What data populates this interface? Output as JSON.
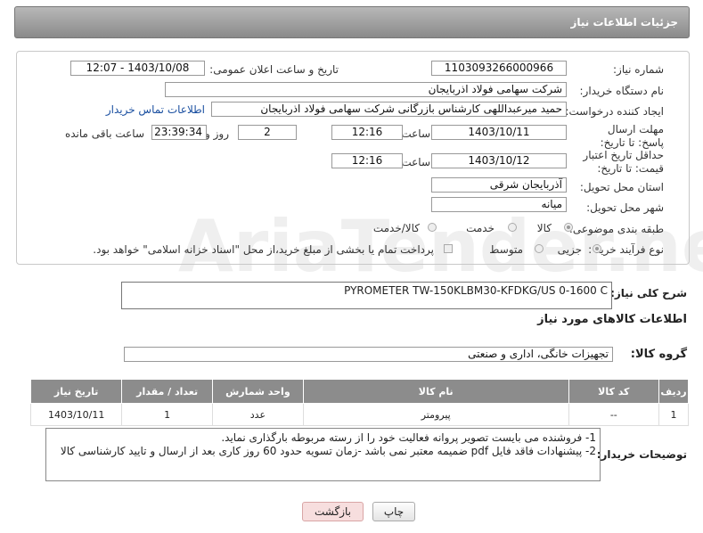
{
  "header": {
    "title": "جزئیات اطلاعات نیاز"
  },
  "form": {
    "need_number_label": "شماره نیاز:",
    "need_number": "1103093266000966",
    "announce_label": "تاریخ و ساعت اعلان عمومی:",
    "announce_value": "1403/10/08 - 12:07",
    "buyer_org_label": "نام دستگاه خریدار:",
    "buyer_org": "شرکت سهامی فولاد اذربایجان",
    "creator_label": "ایجاد کننده درخواست:",
    "creator": "حمید میرعبداللهی کارشناس بازرگانی شرکت سهامی فولاد اذربایجان",
    "contact_link": "اطلاعات تماس خریدار",
    "reply_deadline_label": "مهلت ارسال پاسخ: تا تاریخ:",
    "reply_date": "1403/10/11",
    "time_label": "ساعت",
    "reply_time": "12:16",
    "days": "2",
    "days_label": "روز و",
    "remaining_time": "23:39:34",
    "remaining_label": "ساعت باقی مانده",
    "price_validity_label": "حداقل تاریخ اعتبار قیمت: تا تاریخ:",
    "price_date": "1403/10/12",
    "price_time": "12:16",
    "province_label": "استان محل تحویل:",
    "province": "آذربایجان شرقی",
    "city_label": "شهر محل تحویل:",
    "city": "میانه",
    "category_label": "طبقه بندی موضوعی:",
    "category_options": [
      "کالا",
      "خدمت",
      "کالا/خدمت"
    ],
    "process_label": "نوع فرآیند خرید :",
    "process_options": [
      "جزیی",
      "متوسط"
    ],
    "payment_note": "پرداخت تمام یا بخشی از مبلغ خرید،از محل \"اسناد خزانه اسلامی\" خواهد بود."
  },
  "summary": {
    "label": "شرح کلی نیاز:",
    "value": "PYROMETER TW-150KLBM30-KFDKG/US  0-1600 C"
  },
  "goods_info_title": "اطلاعات کالاهای مورد نیاز",
  "goods_group": {
    "label": "گروه کالا:",
    "value": "تجهیزات خانگی، اداری و صنعتی"
  },
  "table": {
    "headers": [
      "ردیف",
      "کد کالا",
      "نام کالا",
      "واحد شمارش",
      "تعداد / مقدار",
      "تاریخ نیاز"
    ],
    "rows": [
      [
        "1",
        "--",
        "پیرومتر",
        "عدد",
        "1",
        "1403/10/11"
      ]
    ]
  },
  "buyer_notes": {
    "label": "توضیحات خریدار:",
    "line1": "1- فروشنده می بایست تصویر پروانه فعالیت خود را از رسته مربوطه بارگذاری نماید.",
    "line2": "2- پیشنهادات فاقد فایل pdf  ضمیمه معتبر نمی باشد -زمان تسویه حدود 60  روز کاری بعد از ارسال و تایید کارشناسی کالا"
  },
  "buttons": {
    "print": "چاپ",
    "back": "بازگشت"
  },
  "watermark": "AriaTender.neT",
  "colors": {
    "header": "#9a9a9a",
    "link": "#1a4fa0",
    "table_header": "#8c8c8c",
    "back_button": "#f7dede"
  }
}
